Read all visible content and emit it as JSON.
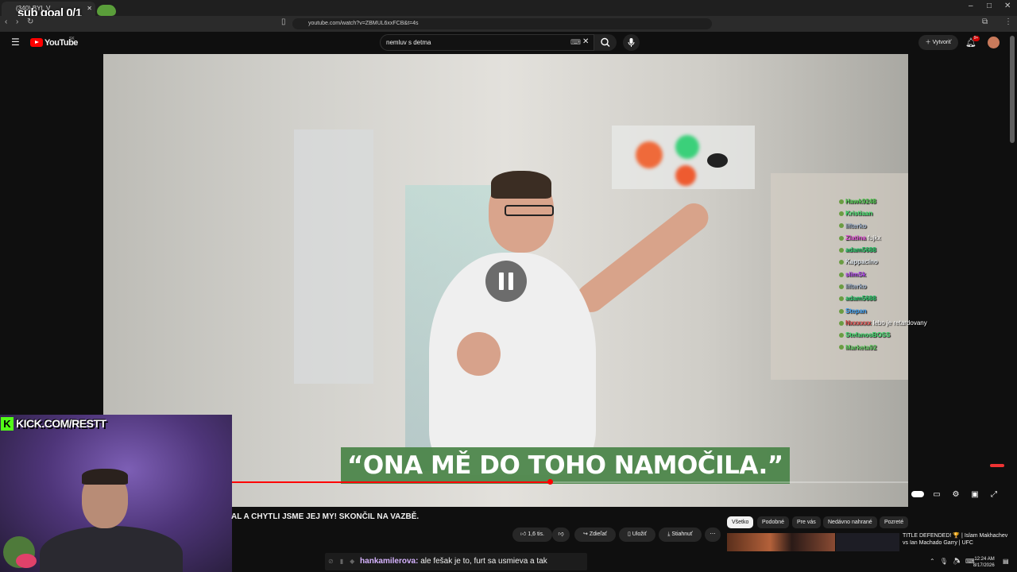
{
  "browser": {
    "tab_title": "(340) BYL V DOKUMENTU...",
    "tab_close": "✕",
    "overlay_sub_goal": "sub goal 0/1",
    "url": "youtube.com/watch?v=ZBMUL6xxFCB&t=4s",
    "window_minimize": "–",
    "window_maximize": "□",
    "window_close": "✕"
  },
  "youtube": {
    "logo_text": "YouTube",
    "logo_region": "SK",
    "search_value": "nemluv s detma",
    "create_label": "Vytvoriť",
    "notif_count": "9+"
  },
  "video": {
    "subtitle": "“ONA MĚ DO TOHO NAMOČILA.”",
    "progress_fraction": 0.47,
    "title_partial": "AL A CHYTLI JSME JEJ MY! SKONČIL NA VAZBĚ."
  },
  "overlay_chat": [
    {
      "user": "Hawk9248",
      "msg": "",
      "color": "#4ecb4e"
    },
    {
      "user": "Kristiaan",
      "msg": "",
      "color": "#3fe06a"
    },
    {
      "user": "lifterko",
      "msg": "",
      "color": "#9db0c9"
    },
    {
      "user": "Zlatina",
      "msg": "fujkx",
      "color": "#e14dd6"
    },
    {
      "user": "adam5688",
      "msg": "",
      "color": "#22c766"
    },
    {
      "user": "Kappacino",
      "msg": "",
      "color": "#dfe7ee"
    },
    {
      "user": "slimSk",
      "msg": "",
      "color": "#b246f0"
    },
    {
      "user": "lifterko",
      "msg": "",
      "color": "#9db0c9"
    },
    {
      "user": "adam5688",
      "msg": "",
      "color": "#22c766"
    },
    {
      "user": "Stepan",
      "msg": "",
      "color": "#3d9ef0"
    },
    {
      "user": "Nxxxxxx",
      "msg": "lebo je retardovany",
      "color": "#d84848"
    },
    {
      "user": "StefanosBOSS",
      "msg": "",
      "color": "#3ddd6c"
    },
    {
      "user": "Marketa92",
      "msg": "",
      "color": "#5fce5f"
    }
  ],
  "stream": {
    "kick_text": "KICK.COM/RESTT",
    "kick_logo": "K"
  },
  "actions": {
    "like_count": "1,6 tis.",
    "share": "Zdieľať",
    "save": "Uložiť",
    "download": "Stiahnuť",
    "more": "⋯"
  },
  "chips": [
    "Všetko",
    "Podobné",
    "Pre vás",
    "Nedávno nahrané",
    "Pozreté"
  ],
  "recommendation": {
    "title": "TITLE DEFENDED! 🏆 | Islam Makhachev vs Ian Machado Garry | UFC"
  },
  "kick_chat": {
    "user": "hankamilerova:",
    "message": "ale fešak je to, furt sa usmieva a tak"
  },
  "clock": {
    "time": "12:24 AM",
    "date": "8/17/2026"
  }
}
